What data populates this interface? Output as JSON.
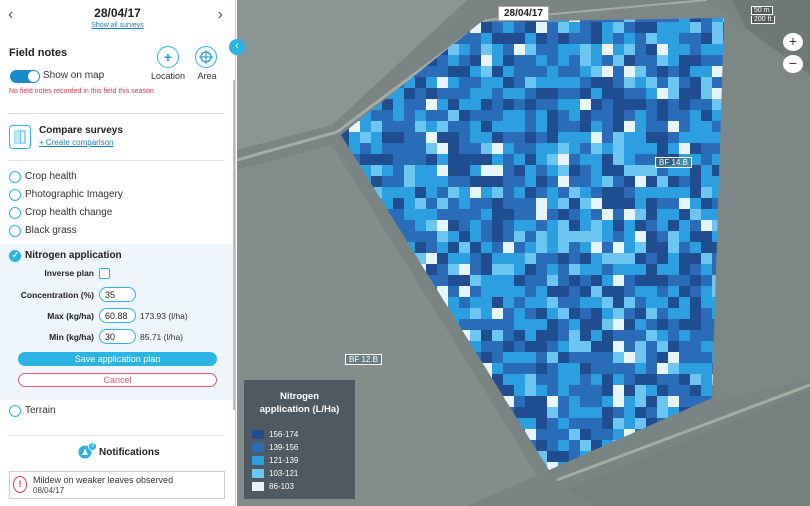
{
  "header": {
    "date": "28/04/17",
    "show_all_surveys": "Show all surveys",
    "prev": "‹",
    "next": "›"
  },
  "field_notes": {
    "title": "Field notes",
    "show_on_map": "Show on map",
    "location_label": "Location",
    "area_label": "Area",
    "empty_message": "No field notes recorded in this field this season"
  },
  "compare": {
    "title": "Compare surveys",
    "link": "+ Create comparison"
  },
  "layers": [
    {
      "label": "Crop health"
    },
    {
      "label": "Photographic Imagery"
    },
    {
      "label": "Crop health change"
    },
    {
      "label": "Black grass"
    }
  ],
  "nitrogen": {
    "title": "Nitrogen application",
    "inverse_plan_label": "Inverse plan",
    "concentration_label": "Concentration (%)",
    "concentration_value": "35",
    "max_label": "Max (kg/ha)",
    "max_value": "60.88",
    "max_unit": "173.93 (l/ha)",
    "min_label": "Min (kg/ha)",
    "min_value": "30",
    "min_unit": "85.71 (l/ha)",
    "save_label": "Save application plan",
    "cancel_label": "Cancel"
  },
  "terrain": {
    "label": "Terrain"
  },
  "notifications": {
    "title": "Notifications",
    "count": "3",
    "items": [
      {
        "text": "Mildew on weaker leaves observed",
        "date": "08/04/17"
      }
    ]
  },
  "map": {
    "date_tag": "28/04/17",
    "scale_m": "50 m",
    "scale_ft": "200 ft",
    "zoom_in": "+",
    "zoom_out": "−",
    "field_labels": [
      "BF 14.B",
      "BF 12.B"
    ]
  },
  "legend": {
    "title_line1": "Nitrogen",
    "title_line2": "application (L/Ha)",
    "items": [
      {
        "label": "156-174",
        "color": "#1f4d8f"
      },
      {
        "label": "139-156",
        "color": "#2b6cb8"
      },
      {
        "label": "121-139",
        "color": "#2c9fe0"
      },
      {
        "label": "103-121",
        "color": "#6cc6ef"
      },
      {
        "label": "86-103",
        "color": "#e8f4fb"
      }
    ]
  }
}
